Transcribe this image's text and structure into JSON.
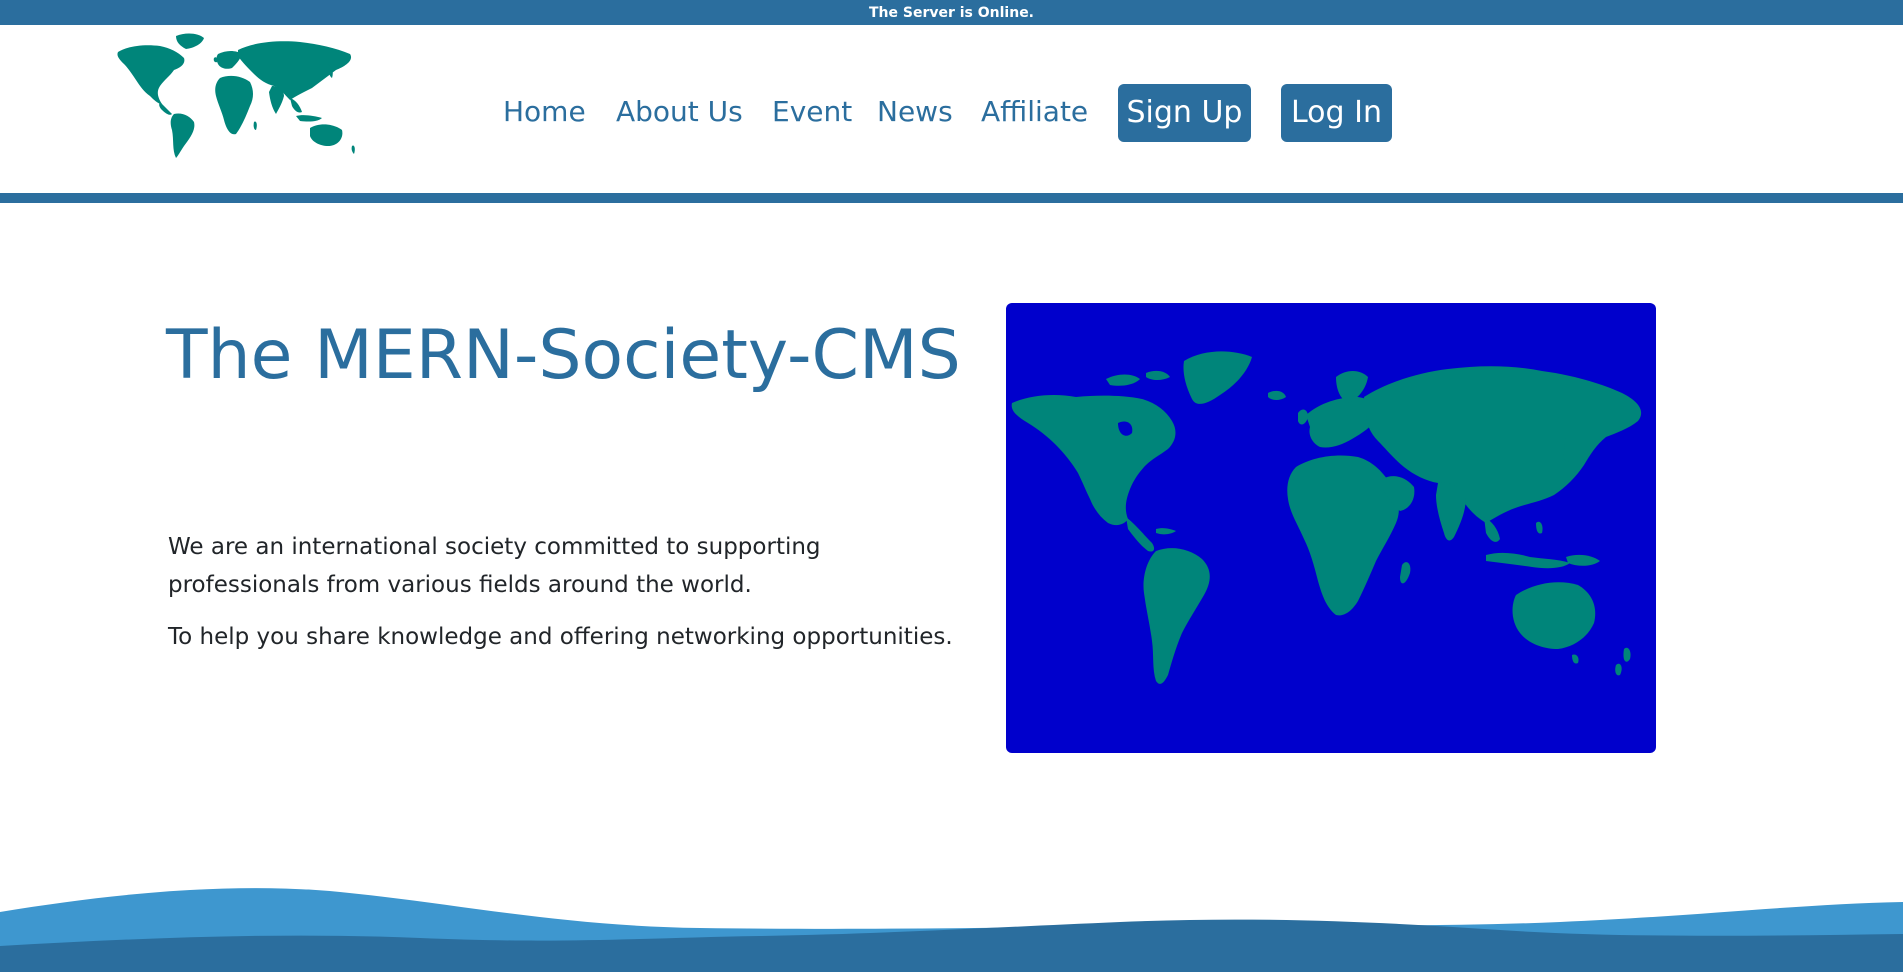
{
  "status": {
    "message": "The Server is Online."
  },
  "header": {
    "logo_icon": "world-map-logo",
    "nav": {
      "home": "Home",
      "about": "About Us",
      "event": "Event",
      "news": "News",
      "affiliate": "Affiliate"
    },
    "signup_label": "Sign Up",
    "login_label": "Log In"
  },
  "hero": {
    "title": "The MERN-Society-CMS",
    "paragraph_1": "We are an international society committed to supporting professionals from various fields around the world.",
    "paragraph_2": "To help you share knowledge and offering networking opportunities.",
    "image_icon": "world-map-illustration"
  },
  "colors": {
    "primary": "#2b6e9e",
    "land": "#00857a",
    "ocean": "#0000cc",
    "wave_light": "#3e97cf",
    "wave_dark": "#2b6e9e",
    "body_text": "#212529"
  }
}
